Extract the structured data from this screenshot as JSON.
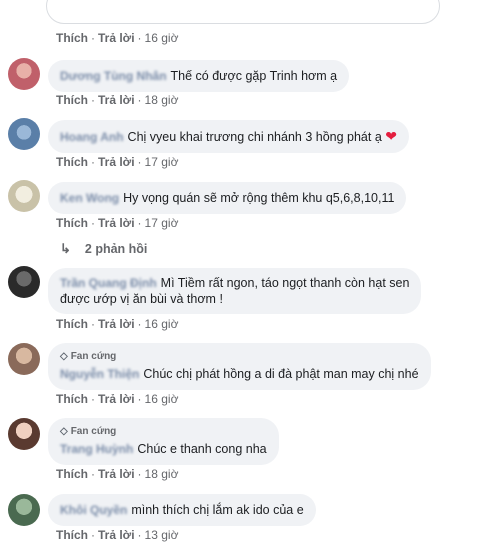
{
  "comments": [
    {
      "name": "Dương Tùng Nhân",
      "text": "Thế có được gặp Trinh hơm ạ",
      "time": "18 giờ",
      "avatar_color": "#c0606a",
      "fan_badge": ""
    },
    {
      "name": "Hoang Anh",
      "text": "Chị vyeu khai trương chi nhánh 3 hồng phát ạ",
      "emoji": "❤",
      "time": "17 giờ",
      "avatar_color": "#5a7fa8",
      "fan_badge": ""
    },
    {
      "name": "Ken Wong",
      "text": "Hy vọng quán sẽ mở rộng thêm khu q5,6,8,10,11",
      "time": "17 giờ",
      "avatar_color": "#c9c2a8",
      "fan_badge": ""
    },
    {
      "name": "Trần Quang Định",
      "text": "Mì Tiềm rất ngon, táo ngọt thanh còn hạt sen",
      "text2": "được ướp vị ăn bùi và thơm !",
      "time": "16 giờ",
      "avatar_color": "#3a3a3a",
      "fan_badge": ""
    },
    {
      "name": "Nguyễn Thiện",
      "text": "Chúc chị phát hồng a di đà phật man may chị nhé",
      "time": "16 giờ",
      "avatar_color": "#8a6a5a",
      "fan_badge": "Fan cứng"
    },
    {
      "name": "Trang Huỳnh",
      "text": "Chúc e thanh cong nha",
      "time": "18 giờ",
      "avatar_color": "#b89080",
      "fan_badge": "Fan cứng"
    },
    {
      "name": "Khôi Quyền",
      "text": "mình thích chị lắm ak ido của e",
      "time": "13 giờ",
      "avatar_color": "#4a6a50",
      "fan_badge": ""
    }
  ],
  "top_actions": {
    "like": "Thích",
    "reply": "Trả lời",
    "time": "16 giờ"
  },
  "labels": {
    "like": "Thích",
    "reply": "Trả lời",
    "dot": "·"
  },
  "replies_link": "2 phản hồi",
  "colors": {
    "heart": "#e41e3f",
    "bubble": "#f0f2f5",
    "meta": "#65676b"
  }
}
